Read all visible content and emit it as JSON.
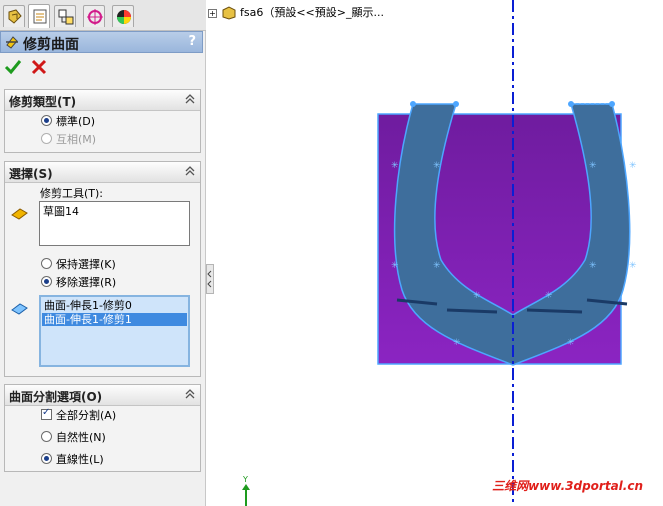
{
  "tree": {
    "node_label": "fsa6（預設<<預設>_顯示..."
  },
  "panel": {
    "tabs": [
      "feature-manager-icon",
      "property-manager-icon",
      "configuration-manager-icon",
      "dimxpert-icon",
      "display-manager-icon"
    ],
    "title": "修剪曲面",
    "help_label": "?",
    "trim_type": {
      "title": "修剪類型(T)",
      "options": [
        {
          "label": "標準(D)",
          "selected": true,
          "enabled": true
        },
        {
          "label": "互相(M)",
          "selected": false,
          "enabled": false
        }
      ]
    },
    "selections": {
      "title": "選擇(S)",
      "trim_tool_label": "修剪工具(T):",
      "trim_tool_value": "草圖14",
      "options": [
        {
          "label": "保持選擇(K)",
          "selected": false
        },
        {
          "label": "移除選擇(R)",
          "selected": true
        }
      ],
      "list_items": [
        {
          "label": "曲面-伸長1-修剪0",
          "selected": false
        },
        {
          "label": "曲面-伸長1-修剪1",
          "selected": true
        }
      ]
    },
    "surface_split": {
      "title": "曲面分割選項(O)",
      "split_all": {
        "label": "全部分割(A)",
        "checked": true
      },
      "options": [
        {
          "label": "自然性(N)",
          "selected": false
        },
        {
          "label": "直線性(L)",
          "selected": true
        }
      ]
    }
  },
  "colors": {
    "surface_top": "#7a1fa8",
    "surface_bottom": "#8a22bf",
    "shape_fill": "#3e6e9c",
    "sketch_line": "#4da6ff",
    "axis_line": "#0a1fd4",
    "accent_blue": "#3f8ae0"
  },
  "watermark": "三维网www.3dportal.cn"
}
